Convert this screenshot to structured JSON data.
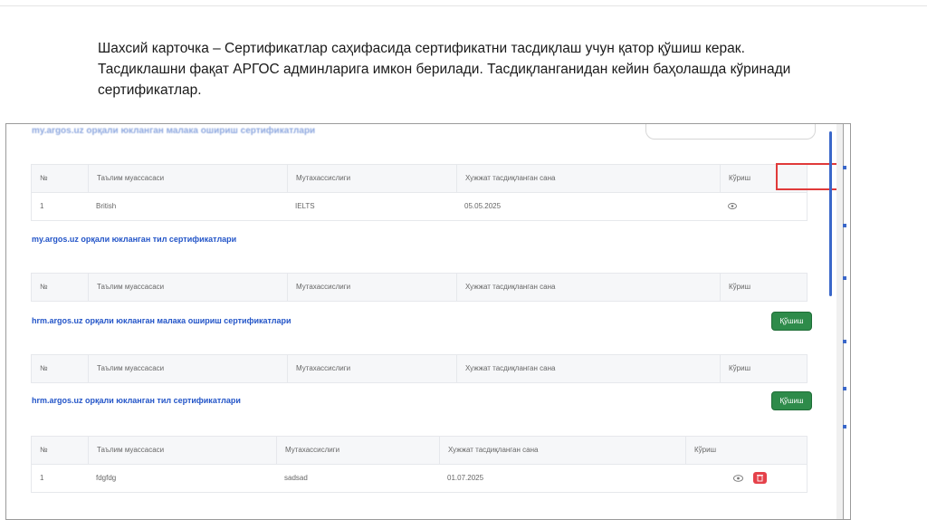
{
  "caption": {
    "line1": "Шахсий карточка – Сертификатлар саҳифасида сертификатни тасдиқлаш учун қатор қўшиш керак.",
    "line2": "Тасдиклашни фақат АРГОС админларига имкон берилади. Тасдиқланганидан кейин баҳолашда кўринади",
    "line3": "сертификатлар."
  },
  "screenshot": {
    "top_cut_heading": "my.argos.uz орқали юкланган малака ошириш сертификатлари",
    "columns": {
      "num": "№",
      "institution": "Таълим муассасаси",
      "specialty": "Мутахассислиги",
      "date": "Хужжат тасдиқланган сана",
      "view": "Кўриш"
    },
    "table1": {
      "rows": [
        {
          "num": "1",
          "institution": "British",
          "specialty": "IELTS",
          "date": "05.05.2025"
        }
      ]
    },
    "section2": {
      "title": "my.argos.uz орқали юкланган тил сертификатлари"
    },
    "section3": {
      "title": "hrm.argos.uz орқали юкланган малака ошириш сертификатлари",
      "add_button": "Қўшиш"
    },
    "section4": {
      "title": "hrm.argos.uz орқали юкланган тил сертификатлари",
      "add_button": "Қўшиш",
      "rows": [
        {
          "num": "1",
          "institution": "fdgfdg",
          "specialty": "sadsad",
          "date": "01.07.2025"
        }
      ]
    }
  },
  "colors": {
    "link_blue": "#2355c8",
    "add_green": "#2e8b4a",
    "highlight_red": "#e03a3a",
    "delete_red": "#e5414a"
  }
}
